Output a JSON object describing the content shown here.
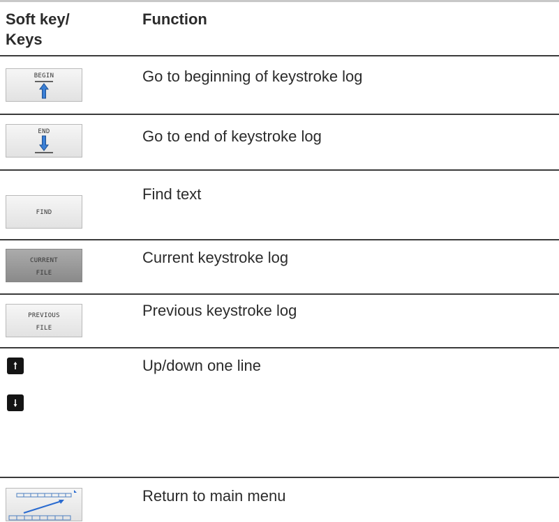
{
  "header": {
    "col_key": "Soft key/\nKeys",
    "col_function": "Function"
  },
  "rows": [
    {
      "key_label": "BEGIN",
      "icon": "arrow-up-to-line-icon",
      "function": "Go to beginning of keystroke log"
    },
    {
      "key_label": "END",
      "icon": "arrow-down-to-line-icon",
      "function": "Go to end of keystroke log"
    },
    {
      "key_label": "FIND",
      "function": "Find text"
    },
    {
      "key_label_1": "CURRENT",
      "key_label_2": "FILE",
      "function": "Current keystroke log"
    },
    {
      "key_label_1": "PREVIOUS",
      "key_label_2": "FILE",
      "function": "Previous keystroke log"
    },
    {
      "keys": [
        "arrow-up-key-icon",
        "arrow-down-key-icon"
      ],
      "function": "Up/down one line"
    },
    {
      "icon": "return-to-main-menu-icon",
      "function": "Return to main menu"
    }
  ]
}
